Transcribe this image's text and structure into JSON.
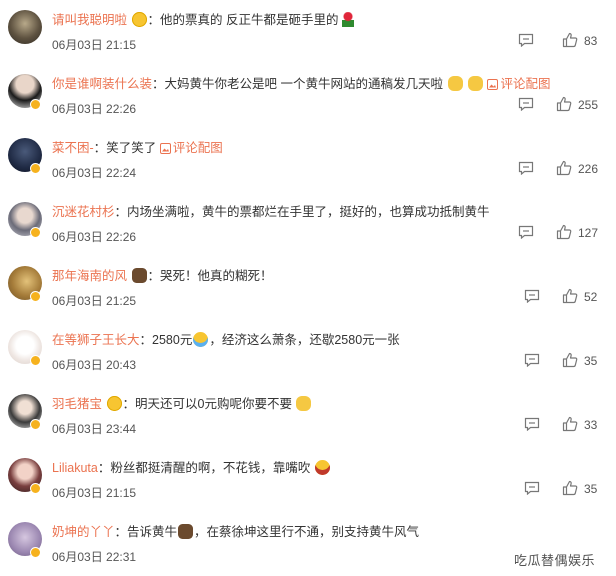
{
  "comments": [
    {
      "user": "请叫我聪明啦",
      "text_before": "他的票真的 反正牛都是砸手里的",
      "text_after": "",
      "link": "",
      "time": "06月03日 21:15",
      "likes": "83",
      "verified": false
    },
    {
      "user": "你是谁啊装什么装",
      "text_before": "大妈黄牛你老公是吧 一个黄牛网站的通稿发几天啦",
      "text_after": "",
      "link": "评论配图",
      "time": "06月03日 22:26",
      "likes": "255",
      "verified": true
    },
    {
      "user": "菜不困-",
      "text_before": "笑了笑了",
      "text_after": "",
      "link": "评论配图",
      "time": "06月03日 22:24",
      "likes": "226",
      "verified": true
    },
    {
      "user": "沉迷花村杉",
      "text_before": "内场坐满啦，黄牛的票都烂在手里了，挺好的，也算成功抵制黄牛",
      "text_after": "",
      "link": "",
      "time": "06月03日 22:26",
      "likes": "127",
      "verified": true
    },
    {
      "user": "那年海南的风",
      "text_before": "哭死！他真的糊死！",
      "text_after": "",
      "link": "",
      "time": "06月03日 21:25",
      "likes": "52",
      "verified": true
    },
    {
      "user": "在等狮子王长大",
      "text_before": "2580元",
      "text_after": "，经济这么萧条，还歇2580元一张",
      "link": "",
      "time": "06月03日 20:43",
      "likes": "35",
      "verified": true
    },
    {
      "user": "羽毛猪宝",
      "text_before": "明天还可以0元购呢你要不要",
      "text_after": "",
      "link": "",
      "time": "06月03日 23:44",
      "likes": "33",
      "verified": true
    },
    {
      "user": "Liliakuta",
      "text_before": "粉丝都挺清醒的啊，不花钱，靠嘴吹",
      "text_after": "",
      "link": "",
      "time": "06月03日 21:15",
      "likes": "35",
      "verified": true
    },
    {
      "user": "奶坤的丫丫",
      "text_before": "告诉黄牛",
      "text_after": "，在蔡徐坤这里行不通，别支持黄牛风气",
      "link": "",
      "time": "06月03日 22:31",
      "likes": "",
      "verified": true
    }
  ],
  "watermark": "吃瓜替偶娱乐",
  "colors": {
    "username": "#eb7350",
    "text": "#333333",
    "meta": "#555555",
    "badge": "#f6b21e"
  }
}
